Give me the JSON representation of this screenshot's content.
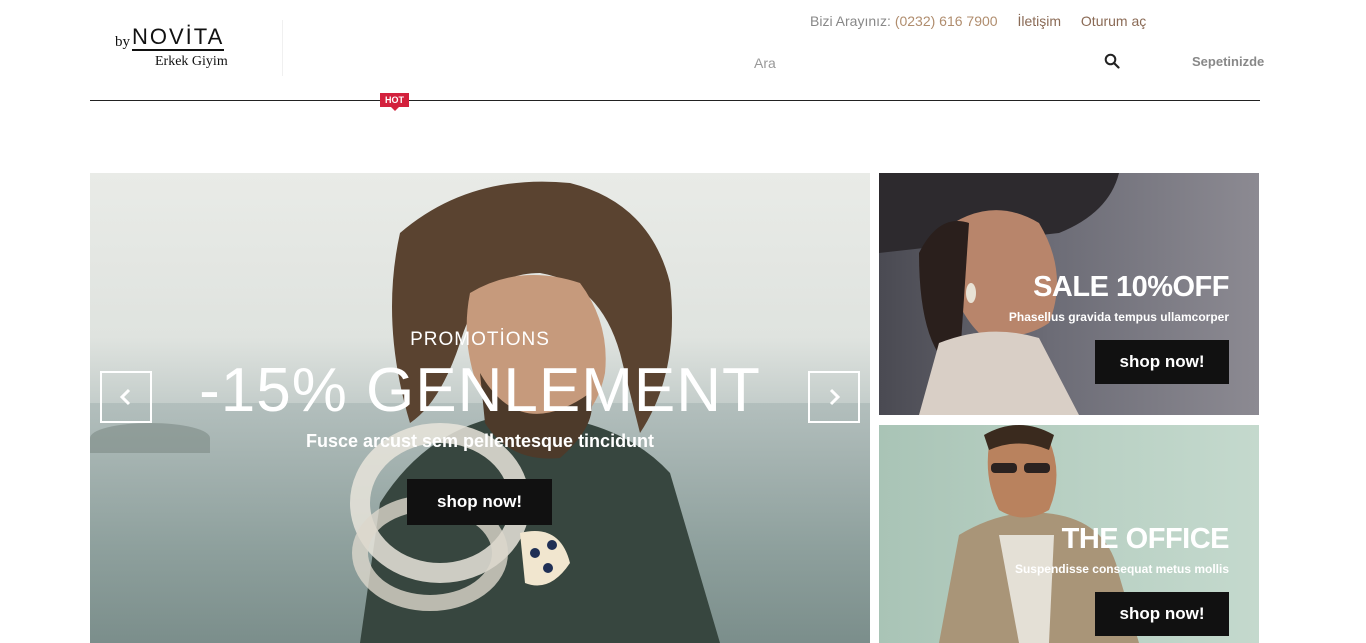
{
  "logo": {
    "by": "by",
    "name": "NOVİTA",
    "subtitle": "Erkek Giyim"
  },
  "topbar": {
    "phone_label": "Bizi Arayınız:",
    "phone_number": "(0232) 616 7900",
    "contact_link": "İletişim",
    "login_link": "Oturum aç"
  },
  "search": {
    "placeholder": "Ara",
    "value": "",
    "icon": "search-icon"
  },
  "cart": {
    "label": "Sepetinizde"
  },
  "nav": {
    "hot_badge": "HOT"
  },
  "hero": {
    "promo": "PROMOTİONS",
    "headline": "-15% GENLEMENT",
    "subline": "Fusce arcust sem pellentesque tincidunt",
    "button": "shop now!",
    "prev_icon": "chevron-left-icon",
    "next_icon": "chevron-right-icon"
  },
  "banners": [
    {
      "title": "SALE 10%OFF",
      "subtitle": "Phasellus gravida tempus ullamcorper",
      "button": "shop now!"
    },
    {
      "title": "THE OFFICE",
      "subtitle": "Suspendisse consequat metus mollis",
      "button": "shop now!"
    }
  ],
  "colors": {
    "accent": "#8a6a55",
    "hot": "#d3213d",
    "button": "#111111"
  }
}
